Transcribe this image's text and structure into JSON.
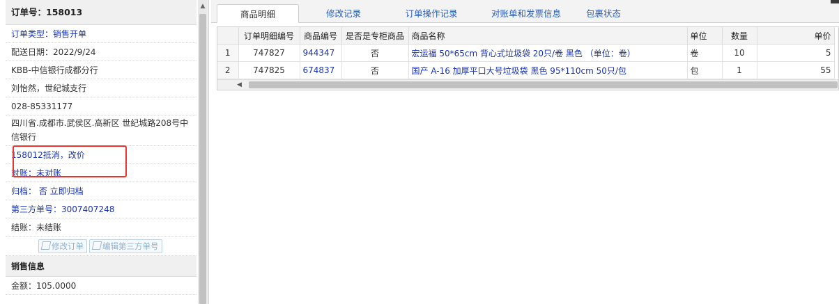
{
  "order": {
    "header": "订单号：158013",
    "type": "订单类型：销售开单",
    "delivery_date": "配送日期：2022/9/24",
    "company": "KBB-中信银行成都分行",
    "contact": "刘怡然，世纪城支行",
    "phone": "028-85331177",
    "address": "四川省.成都市.武侯区.高新区 世纪城路208号中信银行",
    "note": "158012抵消，改价",
    "reconcile": "对账：未对账",
    "archive": "归档： 否 立即归档",
    "third_party": "第三方单号：3007407248",
    "settlement": "结账：未结账",
    "edit_order_button": "修改订单",
    "edit_third_party_button": "编辑第三方单号"
  },
  "sales": {
    "title": "销售信息",
    "amount": "金额：105.0000"
  },
  "tabs": [
    {
      "label": "商品明细",
      "active": true
    },
    {
      "label": "修改记录",
      "active": false
    },
    {
      "label": "订单操作记录",
      "active": false
    },
    {
      "label": "对账单和发票信息",
      "active": false
    },
    {
      "label": "包裹状态",
      "active": false
    }
  ],
  "table": {
    "headers": [
      "",
      "订单明细编号",
      "商品编号",
      "是否是专柜商品",
      "商品名称",
      "单位",
      "数量",
      "单价"
    ],
    "rows": [
      {
        "num": "1",
        "detail_id": "747827",
        "product_id": "944347",
        "is_counter": "否",
        "name": "宏运福 50*65cm 背心式垃圾袋 20只/卷 黑色 （单位：卷）",
        "unit": "卷",
        "qty": "10",
        "price": "5"
      },
      {
        "num": "2",
        "detail_id": "747825",
        "product_id": "674837",
        "is_counter": "否",
        "name": "国产 A-16 加厚平口大号垃圾袋 黑色 95*110cm 50只/包",
        "unit": "包",
        "qty": "1",
        "price": "55"
      }
    ]
  },
  "colors": {
    "link": "#1a33b5",
    "highlight": "#e8362f"
  },
  "icons": {
    "edit": "edit-icon",
    "scroll_left": "arrow-left-icon",
    "scroll_up": "arrow-up-icon"
  }
}
